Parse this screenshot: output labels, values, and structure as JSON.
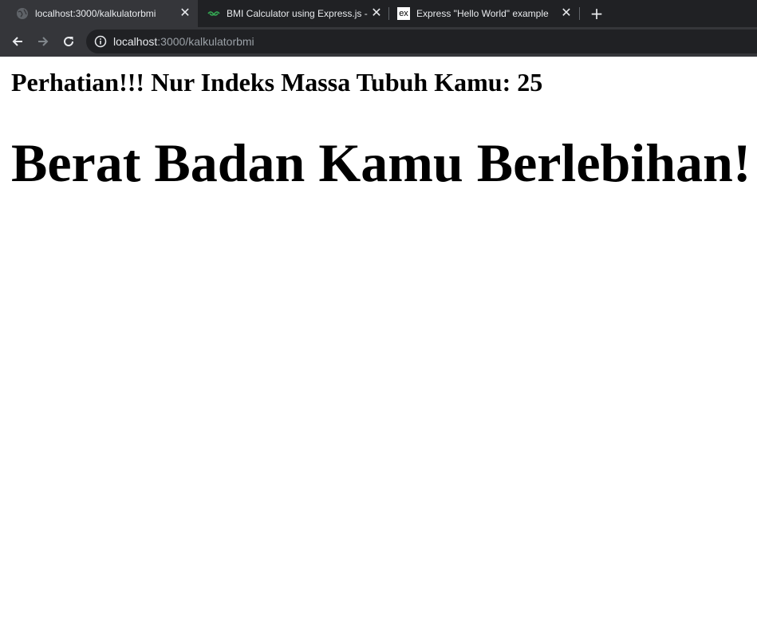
{
  "browser": {
    "tabs": [
      {
        "title": "localhost:3000/kalkulatorbmi",
        "icon": "globe-icon",
        "active": true
      },
      {
        "title": "BMI Calculator using Express.js -",
        "icon": "glitch-icon",
        "active": false
      },
      {
        "title": "Express \"Hello World\" example",
        "icon": "express-icon",
        "favicon_text": "ex",
        "active": false
      }
    ],
    "close_glyph": "✕",
    "new_tab_glyph": "+",
    "address": {
      "host": "localhost",
      "path": ":3000/kalkulatorbmi"
    },
    "colors": {
      "tabstrip": "#202124",
      "toolbar": "#35363a",
      "text": "#e8eaed",
      "url_dim": "#9aa0a6"
    }
  },
  "page": {
    "bmi_message": "Perhatian!!! Nur Indeks Massa Tubuh Kamu: 25",
    "verdict": "Berat Badan Kamu Berlebihan!"
  }
}
